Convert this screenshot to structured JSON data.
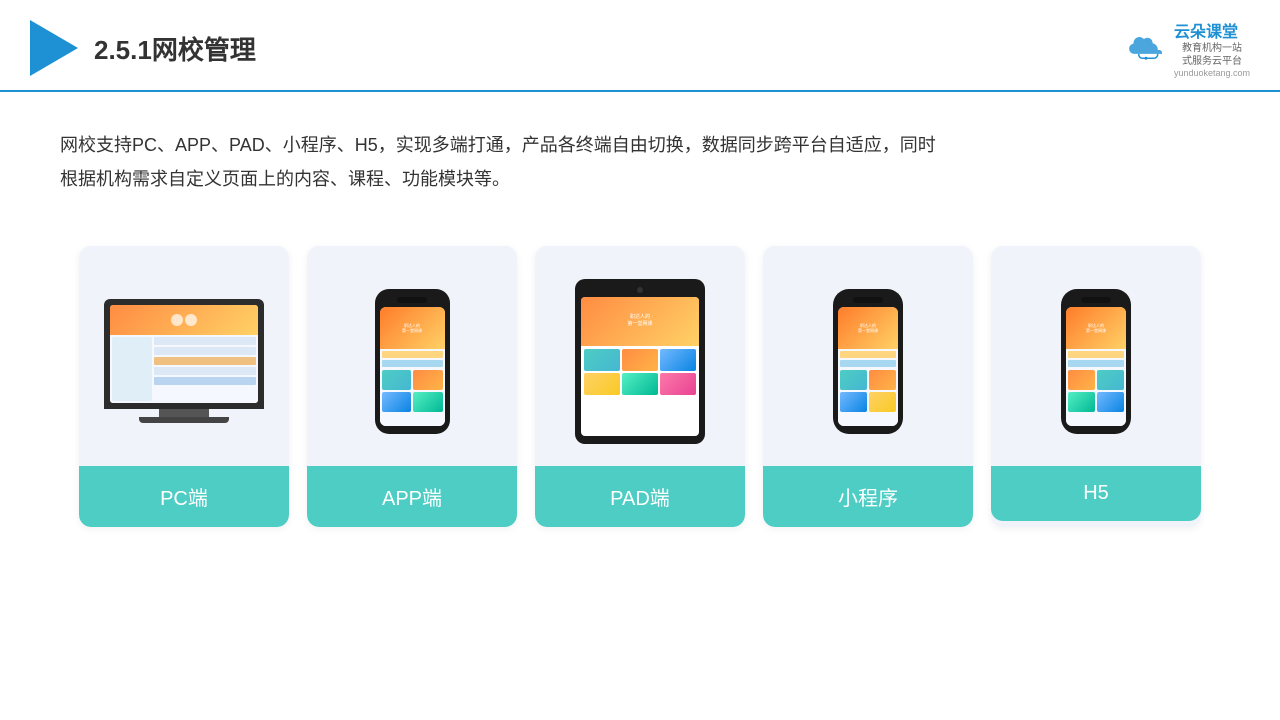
{
  "header": {
    "title": "2.5.1网校管理",
    "brand_name": "云朵课堂",
    "brand_sub_line1": "教育机构一站",
    "brand_sub_line2": "式服务云平台",
    "brand_url": "yunduoketang.com"
  },
  "description": {
    "text": "网校支持PC、APP、PAD、小程序、H5，实现多端打通，产品各终端自由切换，数据同步跨平台自适应，同时根据机构需求自定义页面上的内容、课程、功能模块等。"
  },
  "cards": [
    {
      "id": "pc",
      "label": "PC端"
    },
    {
      "id": "app",
      "label": "APP端"
    },
    {
      "id": "pad",
      "label": "PAD端"
    },
    {
      "id": "miniapp",
      "label": "小程序"
    },
    {
      "id": "h5",
      "label": "H5"
    }
  ]
}
